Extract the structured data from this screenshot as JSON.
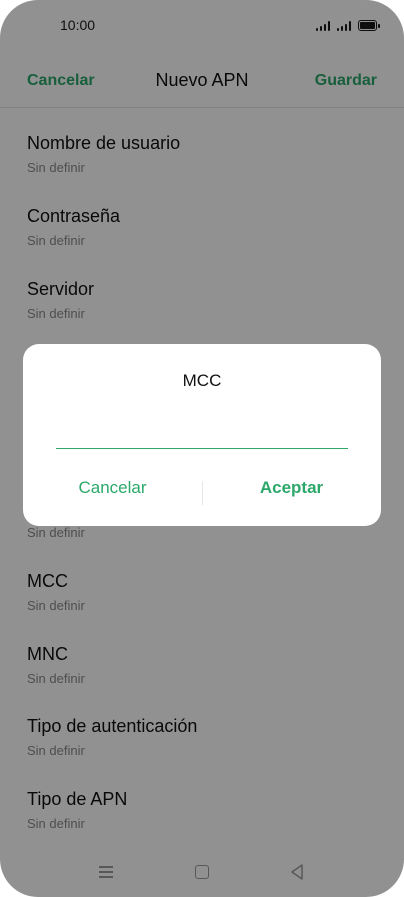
{
  "status_bar": {
    "time": "10:00"
  },
  "header": {
    "cancel_label": "Cancelar",
    "title": "Nuevo APN",
    "save_label": "Guardar"
  },
  "list": {
    "items": [
      {
        "title": "Nombre de usuario",
        "value": "Sin definir"
      },
      {
        "title": "Contraseña",
        "value": "Sin definir"
      },
      {
        "title": "Servidor",
        "value": "Sin definir"
      },
      {
        "title": "",
        "value": "Sin definir"
      },
      {
        "title": "MCC",
        "value": "Sin definir"
      },
      {
        "title": "MNC",
        "value": "Sin definir"
      },
      {
        "title": "Tipo de autenticación",
        "value": "Sin definir"
      },
      {
        "title": "Tipo de APN",
        "value": "Sin definir"
      }
    ]
  },
  "dialog": {
    "title": "MCC",
    "input_value": "",
    "cancel_label": "Cancelar",
    "accept_label": "Aceptar"
  },
  "colors": {
    "accent": "#2ba86a",
    "scrim": "rgba(0,0,0,0.43)"
  },
  "nav_bar": {
    "icons": [
      "menu-icon",
      "home-icon",
      "back-icon"
    ]
  }
}
